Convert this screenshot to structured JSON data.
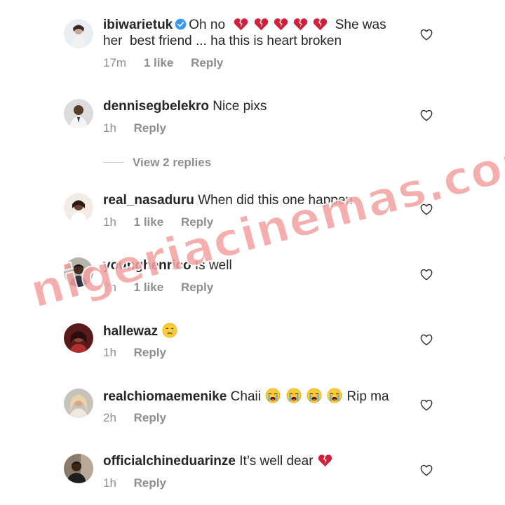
{
  "comments": [
    {
      "username": "ibiwarietuk",
      "verified": true,
      "text_before": "Oh no",
      "emoji": "broken-heart x5",
      "text_after": "She was",
      "line2": "her  best friend ... ha this is heart broken",
      "time": "17m",
      "likes": "1 like",
      "reply": "Reply"
    },
    {
      "username": "dennisegbelekro",
      "text": "Nice pixs",
      "time": "1h",
      "reply": "Reply"
    },
    {
      "username": "real_nasaduru",
      "text": "When did this one happen",
      "time": "1h",
      "likes": "1 like",
      "reply": "Reply"
    },
    {
      "username": "younghenrico",
      "text": "Is well",
      "time": "2h",
      "likes": "1 like",
      "reply": "Reply"
    },
    {
      "username": "hallewaz",
      "emoji": "crying-face",
      "time": "1h",
      "reply": "Reply"
    },
    {
      "username": "realchiomaemenike",
      "text_before": "Chaii",
      "emoji": "loudly-crying-face x4",
      "text_after": "Rip ma",
      "time": "2h",
      "reply": "Reply"
    },
    {
      "username": "officialchineduarinze",
      "text": "It’s well dear",
      "emoji": "broken-heart",
      "time": "1h",
      "reply": "Reply"
    }
  ],
  "view_replies": "View 2 replies",
  "watermark": "nigeriacinemas.com",
  "icons": {
    "like": "heart-outline-icon",
    "verified": "verified-badge-icon"
  },
  "colors": {
    "text": "#262626",
    "muted": "#8e8e8e",
    "verified": "#3897f0",
    "watermark": "#f4a0a0"
  }
}
